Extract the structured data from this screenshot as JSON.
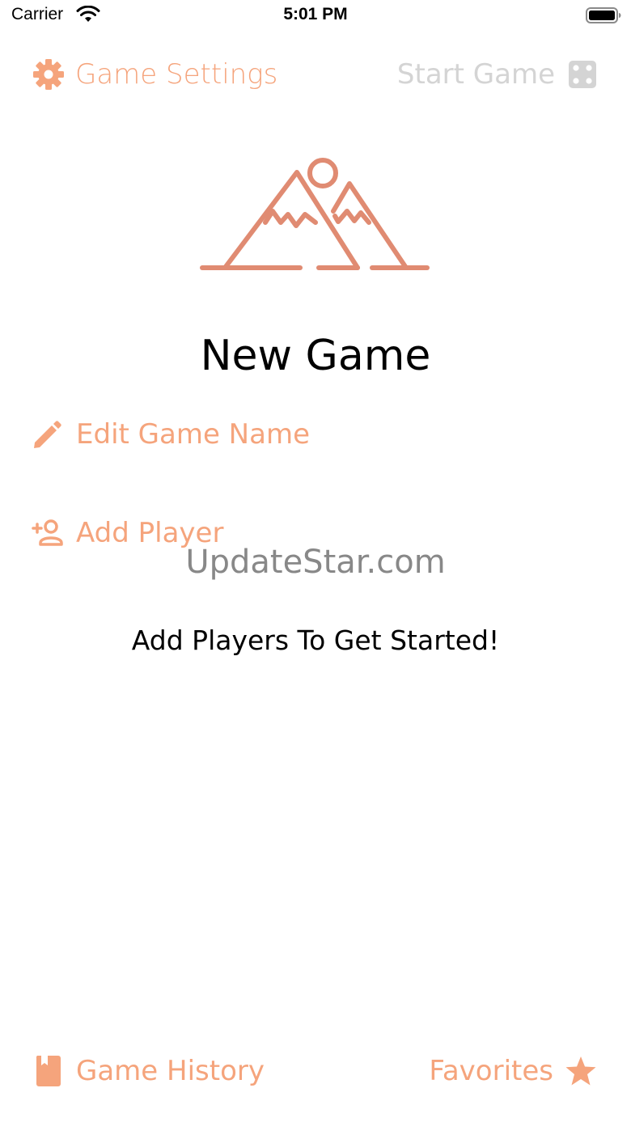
{
  "status_bar": {
    "carrier": "Carrier",
    "time": "5:01 PM"
  },
  "top_nav": {
    "settings_label": "Game Settings",
    "start_label": "Start Game",
    "settings_icon": "gear-icon",
    "start_icon": "die-icon"
  },
  "game": {
    "title": "New Game",
    "illustration": "mountain-icon"
  },
  "actions": {
    "edit_name_label": "Edit Game Name",
    "add_player_label": "Add Player"
  },
  "watermark": "UpdateStar.com",
  "empty_message": "Add Players To Get Started!",
  "bottom_bar": {
    "history_label": "Game History",
    "favorites_label": "Favorites",
    "history_icon": "book-icon",
    "favorites_icon": "star-icon"
  },
  "colors": {
    "accent": "#f5a47c",
    "illustration": "#e08b72",
    "disabled": "#d4d4d4"
  }
}
